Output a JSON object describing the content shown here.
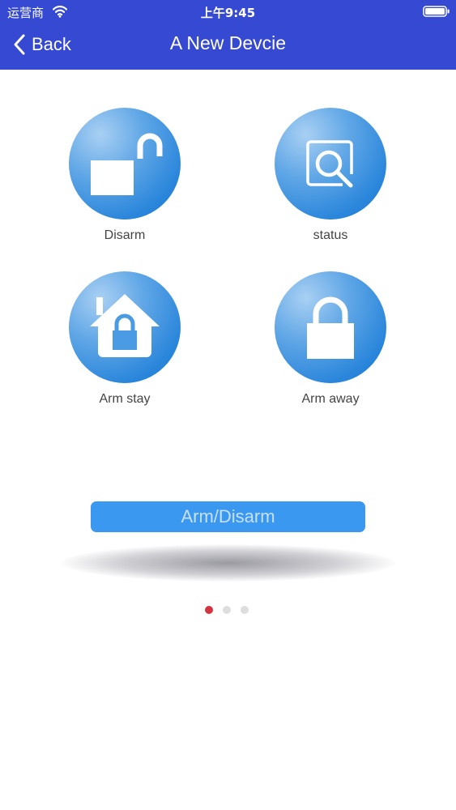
{
  "status_bar": {
    "carrier": "运营商",
    "time": "上午9:45"
  },
  "nav": {
    "back_label": "Back",
    "title": "A New Devcie"
  },
  "tiles": [
    {
      "label": "Disarm",
      "icon": "unlock-icon"
    },
    {
      "label": "status",
      "icon": "magnifier-icon"
    },
    {
      "label": "Arm stay",
      "icon": "home-lock-icon"
    },
    {
      "label": "Arm away",
      "icon": "lock-icon"
    }
  ],
  "main_button": {
    "label": "Arm/Disarm"
  },
  "pager": {
    "pages": 3,
    "active_index": 0
  },
  "colors": {
    "nav_background": "#3549d2",
    "tile_blue": "#2a86db",
    "button_blue": "#3a98f0",
    "active_dot": "#d3343f",
    "inactive_dot": "#dddddd"
  }
}
